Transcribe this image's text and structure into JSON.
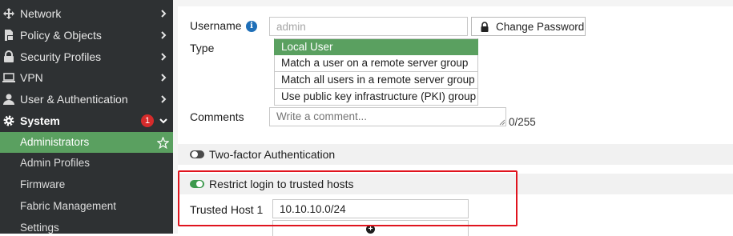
{
  "sidebar": {
    "items": [
      {
        "label": "Network",
        "icon": "network-icon"
      },
      {
        "label": "Policy & Objects",
        "icon": "policy-objects-icon"
      },
      {
        "label": "Security Profiles",
        "icon": "lock-icon"
      },
      {
        "label": "VPN",
        "icon": "monitor-icon"
      },
      {
        "label": "User & Authentication",
        "icon": "user-icon"
      },
      {
        "label": "System",
        "icon": "gear-icon",
        "badge": "1"
      }
    ],
    "subitems": [
      {
        "label": "Administrators",
        "active": true
      },
      {
        "label": "Admin Profiles"
      },
      {
        "label": "Firmware"
      },
      {
        "label": "Fabric Management"
      },
      {
        "label": "Settings"
      }
    ]
  },
  "form": {
    "username_label": "Username",
    "username_value": "admin",
    "change_password_label": "Change Password",
    "type_label": "Type",
    "type_options": [
      "Local User",
      "Match a user on a remote server group",
      "Match all users in a remote server group",
      "Use public key infrastructure (PKI) group"
    ],
    "type_selected": "Local User",
    "comments_label": "Comments",
    "comments_placeholder": "Write a comment...",
    "comments_counter": "0/255",
    "two_factor_label": "Two-factor Authentication",
    "two_factor_enabled": false,
    "restrict_label": "Restrict login to trusted hosts",
    "restrict_enabled": true,
    "trusted_host_label": "Trusted Host 1",
    "trusted_host_value": "10.10.10.0/24"
  },
  "colors": {
    "sidebar_bg": "#2e3133",
    "accent_green": "#5aa060",
    "badge_red": "#d62b2b",
    "highlight_red": "#e0141e",
    "info_blue": "#1f6fb8"
  }
}
